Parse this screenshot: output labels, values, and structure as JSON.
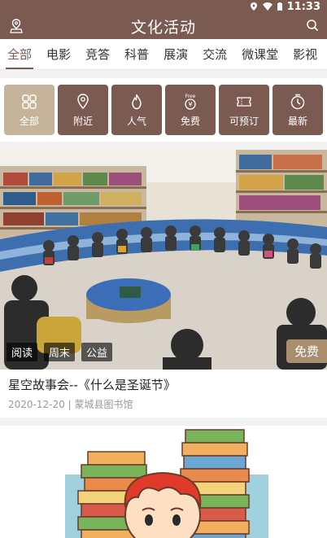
{
  "status_bar": {
    "time": "11:33"
  },
  "app_bar": {
    "title": "文化活动"
  },
  "tabs": [
    {
      "label": "全部",
      "active": true
    },
    {
      "label": "电影"
    },
    {
      "label": "竞答"
    },
    {
      "label": "科普"
    },
    {
      "label": "展演"
    },
    {
      "label": "交流"
    },
    {
      "label": "微课堂"
    },
    {
      "label": "影视"
    }
  ],
  "filters": [
    {
      "label": "全部",
      "icon": "grid-icon",
      "active": true
    },
    {
      "label": "附近",
      "icon": "location-pin-icon"
    },
    {
      "label": "人气",
      "icon": "flame-icon"
    },
    {
      "label": "免费",
      "icon": "free-yen-icon",
      "icon_text": "Free"
    },
    {
      "label": "可预订",
      "icon": "ticket-icon"
    },
    {
      "label": "最新",
      "icon": "clock-icon"
    }
  ],
  "cards": [
    {
      "tags": [
        "阅读",
        "周末",
        "公益"
      ],
      "price": "免费",
      "title": "星空故事会--《什么是圣诞节》",
      "date": "2020-12-20",
      "venue": "蒙城县图书馆"
    }
  ],
  "colors": {
    "brand": "#7b5a52",
    "filter_active": "#c5b49a"
  }
}
